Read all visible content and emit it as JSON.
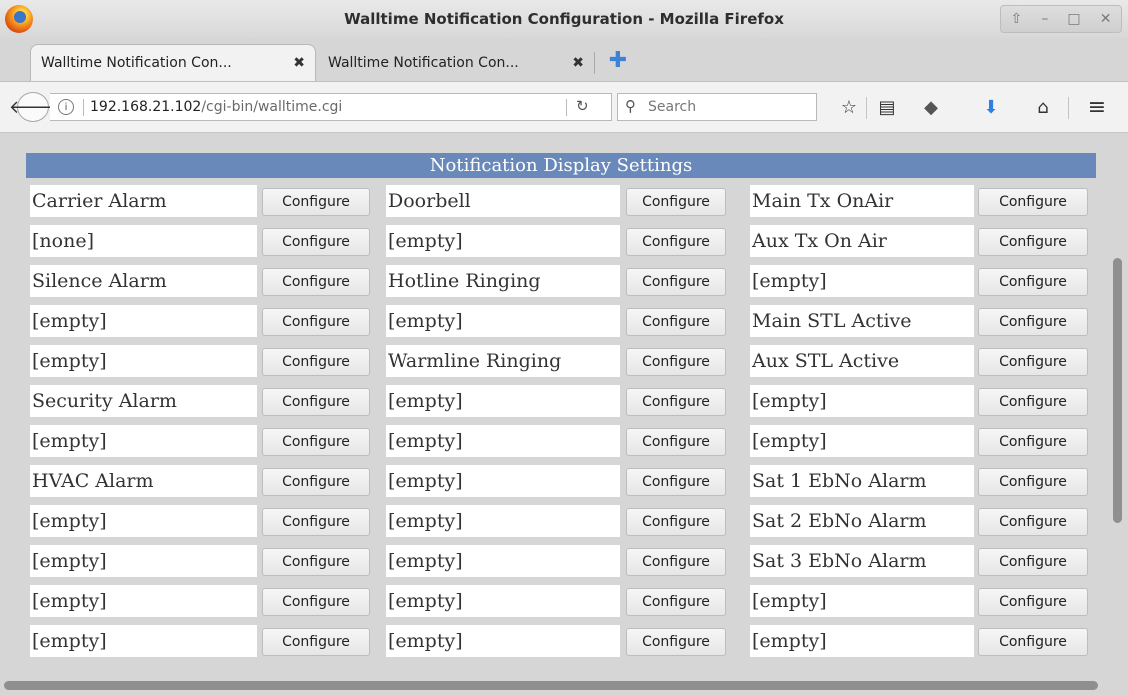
{
  "window": {
    "title": "Walltime Notification Configuration - Mozilla Firefox",
    "controls": [
      "⇧",
      "–",
      "□",
      "✕"
    ]
  },
  "tabs": [
    {
      "label": "Walltime Notification Con...",
      "close": "✖"
    },
    {
      "label": "Walltime Notification Con...",
      "close": "✖"
    }
  ],
  "newtab": "✚",
  "nav": {
    "back": "🡐",
    "url_host": "192.168.21.102",
    "url_path": "/cgi-bin/walltime.cgi",
    "search_placeholder": "Search",
    "icons": {
      "star": "☆",
      "reader": "▤",
      "pocket": "◆",
      "download": "⬇",
      "home": "⌂",
      "menu": "≡"
    }
  },
  "page": {
    "header": "Notification Display Settings",
    "button_label": "Configure",
    "rows": [
      [
        "Carrier Alarm",
        "Doorbell",
        "Main Tx OnAir"
      ],
      [
        "[none]",
        "[empty]",
        "Aux Tx On Air"
      ],
      [
        "Silence Alarm",
        "Hotline Ringing",
        "[empty]"
      ],
      [
        "[empty]",
        "[empty]",
        "Main STL Active"
      ],
      [
        "[empty]",
        "Warmline Ringing",
        "Aux STL Active"
      ],
      [
        "Security Alarm",
        "[empty]",
        "[empty]"
      ],
      [
        "[empty]",
        "[empty]",
        "[empty]"
      ],
      [
        "HVAC Alarm",
        "[empty]",
        "Sat 1 EbNo Alarm"
      ],
      [
        "[empty]",
        "[empty]",
        "Sat 2 EbNo Alarm"
      ],
      [
        "[empty]",
        "[empty]",
        "Sat 3 EbNo Alarm"
      ],
      [
        "[empty]",
        "[empty]",
        "[empty]"
      ],
      [
        "[empty]",
        "[empty]",
        "[empty]"
      ]
    ]
  }
}
